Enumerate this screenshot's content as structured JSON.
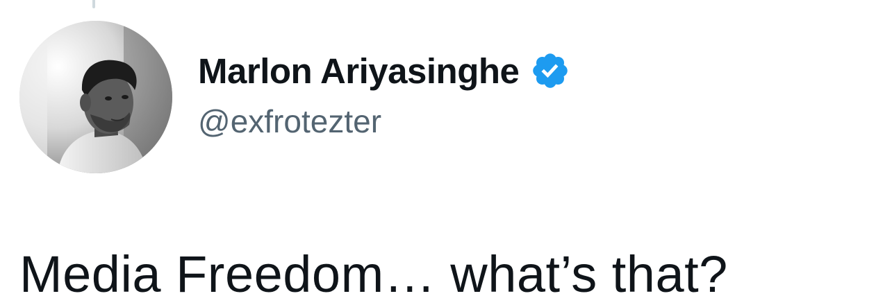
{
  "author": {
    "display_name": "Marlon Ariyasinghe",
    "handle": "@exfrotezter",
    "verified": true
  },
  "tweet": {
    "text": "Media Freedom… what’s that?"
  },
  "colors": {
    "text_primary": "#0f1419",
    "text_secondary": "#536471",
    "verified_badge": "#1d9bf0",
    "background": "#ffffff"
  },
  "icons": {
    "verified": "verified-badge-icon"
  }
}
